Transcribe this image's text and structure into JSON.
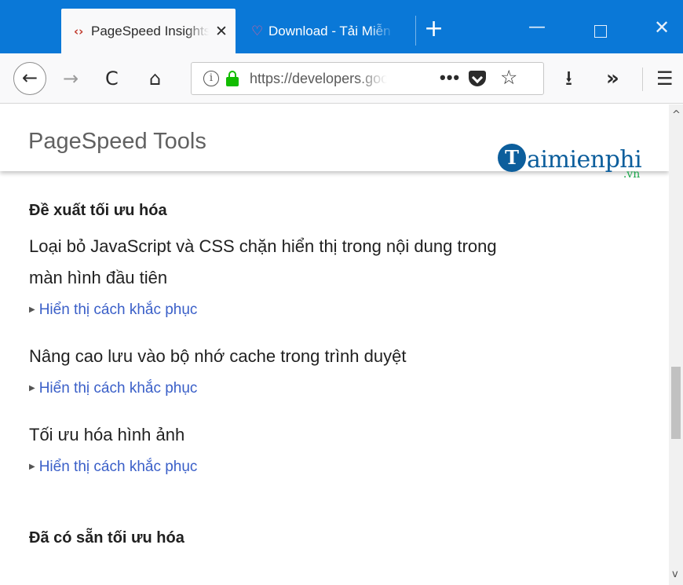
{
  "tabs": [
    {
      "title": "PageSpeed Insights",
      "icon": "code-brackets-icon",
      "close": "✕"
    },
    {
      "title": "Download - Tải Miễn Phí",
      "icon": "heart-icon"
    }
  ],
  "window": {
    "new_tab": "+",
    "minimize": "—",
    "close": "✕"
  },
  "nav": {
    "back": "←",
    "forward": "→",
    "reload": "C",
    "home": "⌂",
    "url": "https://developers.google.com/speed/pagespeed",
    "page_actions": "•••",
    "bookmark": "☆",
    "download": "⭳",
    "overflow": "»",
    "menu": "☰"
  },
  "page": {
    "title": "PageSpeed Tools",
    "logo": {
      "letter": "T",
      "text": "aimienphi",
      "suffix": ".vn"
    },
    "suggestions_heading": "Đề xuất tối ưu hóa",
    "rules": [
      {
        "line1": "Loại bỏ JavaScript và CSS chặn hiển thị trong nội dung trong",
        "line2": "màn hình đầu tiên",
        "link": "Hiển thị cách khắc phục"
      },
      {
        "line1": "Nâng cao lưu vào bộ nhớ cache trong trình duyệt",
        "link": "Hiển thị cách khắc phục"
      },
      {
        "line1": "Tối ưu hóa hình ảnh",
        "link": "Hiển thị cách khắc phục"
      }
    ],
    "found_heading": "Đã có sẵn tối ưu hóa"
  },
  "scrollbar": {
    "up": "^",
    "down": "v",
    "position_fraction": 0.55
  },
  "colors": {
    "titlebar": "#0a78d7",
    "link": "#3a5fc8",
    "lock": "#12bc00",
    "logo": "#0c5e9c",
    "logo_suffix": "#1aa64a"
  }
}
